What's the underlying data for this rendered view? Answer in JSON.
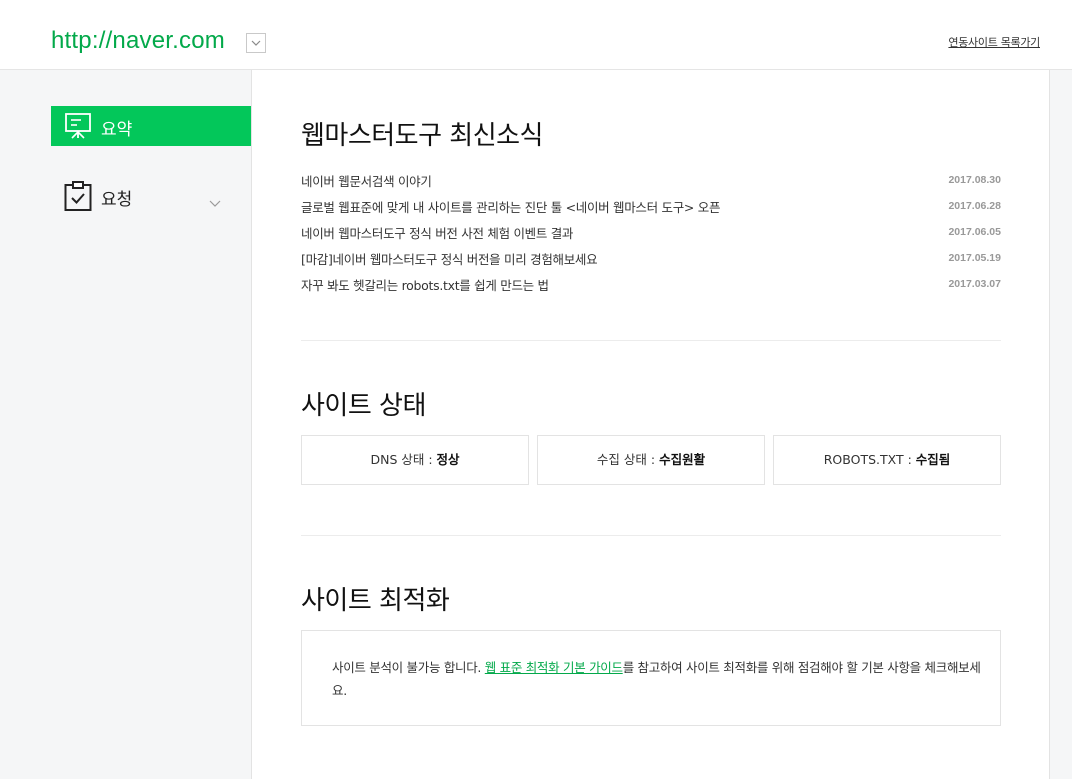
{
  "header": {
    "site_url": "http://naver.com",
    "site_list_link": "연동사이트 목록가기"
  },
  "sidebar": {
    "items": [
      {
        "label": "요약",
        "icon": "presentation-board-icon",
        "active": true
      },
      {
        "label": "요청",
        "icon": "clipboard-check-icon",
        "active": false
      }
    ]
  },
  "news": {
    "title": "웹마스터도구 최신소식",
    "items": [
      {
        "title": "네이버 웹문서검색 이야기",
        "date": "2017.08.30"
      },
      {
        "title": "글로벌 웹표준에 맞게 내 사이트를 관리하는 진단 툴 <네이버 웹마스터 도구> 오픈",
        "date": "2017.06.28"
      },
      {
        "title": "네이버 웹마스터도구 정식 버전 사전 체험 이벤트 결과",
        "date": "2017.06.05"
      },
      {
        "title": "[마감]네이버 웹마스터도구 정식 버전을 미리 경험해보세요",
        "date": "2017.05.19"
      },
      {
        "title": "자꾸 봐도 헷갈리는 robots.txt를 쉽게 만드는 법",
        "date": "2017.03.07"
      }
    ]
  },
  "status": {
    "title": "사이트 상태",
    "items": [
      {
        "label": "DNS 상태 : ",
        "value": "정상"
      },
      {
        "label": "수집 상태 : ",
        "value": "수집원활"
      },
      {
        "label": "ROBOTS.TXT : ",
        "value": "수집됨"
      }
    ]
  },
  "optimization": {
    "title": "사이트 최적화",
    "text_before": "사이트 분석이 불가능 합니다. ",
    "link": "웹 표준 최적화 기본 가이드",
    "text_after": "를 참고하여 사이트 최적화를 위해 점검해야 할 기본 사항을 체크해보세요."
  },
  "colors": {
    "accent": "#03c75a",
    "url_green": "#03a94a"
  }
}
